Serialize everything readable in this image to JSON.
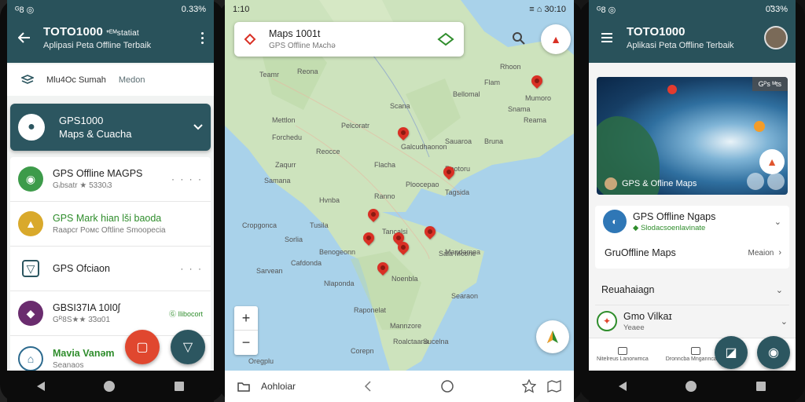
{
  "left_phone": {
    "status": {
      "left": "ᴳ8 ◎",
      "right": "0.33%"
    },
    "title": "TOTO1000",
    "title_small": "*ᴱᴹstatiat",
    "subtitle": "Aplipasi Peta Offline Terbaik",
    "filter": {
      "label1": "Mlu4Oc Sumah",
      "label2": "Medon"
    },
    "card": {
      "line1": "GPS1000",
      "line2": "Maps & Cuacha"
    },
    "rows": [
      {
        "title": "GPS Offline MAGPS",
        "sub_prefix": "Gᵢbsatr ★",
        "stars": "★",
        "sub_suffix": "5330ᵢ3",
        "more": "· · · ·",
        "color": "#3d9b4a"
      },
      {
        "title": "GPS Mark hian lši baoda",
        "sub_prefix": "Raapcr Poᴍc Oftline Smoopecia",
        "stars": "",
        "sub_suffix": "",
        "more": "",
        "color": "#d9a92b",
        "green_title": true
      },
      {
        "title": "GPS Ofᴄiaon",
        "sub_prefix": "",
        "stars": "",
        "sub_suffix": "",
        "more": "· · ·",
        "color": "#ffffff",
        "outline": true
      },
      {
        "title": "GBSI37IA 10I0ʃ",
        "sub_prefix": "Gᴿ8S★★",
        "stars": "★★",
        "sub_suffix": "3̃3ɑ01",
        "more": "Ⓖ Ilibocort",
        "color": "#6a2c6e"
      },
      {
        "title": "Mavia Vanəm",
        "sub_prefix": "Seanaos",
        "stars": "",
        "sub_suffix": "",
        "more": "",
        "color": "#2c6a8e",
        "green_title": true
      }
    ]
  },
  "map_phone": {
    "status": {
      "left": "1:10",
      "right": "≡ ⌂ 30:10"
    },
    "search_title": "Maps 1001t",
    "search_sub": "GPS Offline Mᴀchə",
    "zoom_in": "+",
    "zoom_out": "−",
    "labels": [
      {
        "text": "Reona"
      },
      {
        "text": "Teamr"
      },
      {
        "text": "Rhoon"
      },
      {
        "text": "Flam"
      },
      {
        "text": "Mettlon"
      },
      {
        "text": "Forchedu"
      },
      {
        "text": "Bellomal"
      },
      {
        "text": "Mumoro"
      },
      {
        "text": "Snama"
      },
      {
        "text": "Scana"
      },
      {
        "text": "Reama"
      },
      {
        "text": "Pelcoratr"
      },
      {
        "text": "Galcudhaonon"
      },
      {
        "text": "Sauaroa"
      },
      {
        "text": "Bruna"
      },
      {
        "text": "Reocce"
      },
      {
        "text": "Zaqurr"
      },
      {
        "text": "Samana"
      },
      {
        "text": "Flacha"
      },
      {
        "text": "Rootoru"
      },
      {
        "text": "Ploocepao"
      },
      {
        "text": "Tagsida"
      },
      {
        "text": "Ranno"
      },
      {
        "text": "Hvnba"
      },
      {
        "text": "Tusila"
      },
      {
        "text": "Cropgonca"
      },
      {
        "text": "Sorlia"
      },
      {
        "text": "Mandamea"
      },
      {
        "text": "Benogeonn"
      },
      {
        "text": "Cafdonda"
      },
      {
        "text": "Tancalsi"
      },
      {
        "text": "Sala Mcone"
      },
      {
        "text": "Noenbla"
      },
      {
        "text": "Sarvean"
      },
      {
        "text": "Nlaponda"
      },
      {
        "text": "Searaon"
      },
      {
        "text": "Raponelat"
      },
      {
        "text": "Mannzore"
      },
      {
        "text": "Roalctaana"
      },
      {
        "text": "Sucelna"
      },
      {
        "text": "Corepn"
      },
      {
        "text": "Oregplu"
      }
    ],
    "bottom_label": "Aohloiar"
  },
  "right_phone": {
    "status": {
      "left": "ᴳ8 ◎",
      "right": "0̃33%"
    },
    "title": "TOTO1000",
    "subtitle": "Aplikasi Peta Offline Terbaik",
    "hero_tag": "Gᴾs ᴹts",
    "hero_caption": "GPS & Ofline Maps",
    "card_title": "GPS Offline Ngaps",
    "card_sub": "◆ Slodacsoenlavinate",
    "row2_left": "GruOffline Maps",
    "row2_right": "Meaion",
    "row3": "Reuahaiagn",
    "row4_title": "Gmo Vilkaɪ",
    "row4_sub": "Yeaee",
    "tabs": [
      {
        "label": "Nitelreus Lanorwmca"
      },
      {
        "label": "Dronncba Mnganncaapo"
      }
    ]
  }
}
